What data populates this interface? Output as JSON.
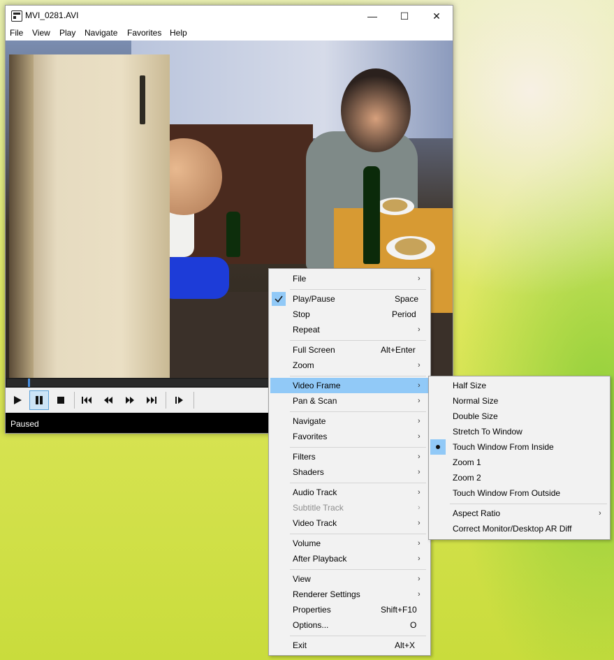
{
  "window": {
    "title": "MVI_0281.AVI",
    "controls": {
      "minimize": "—",
      "maximize": "☐",
      "close": "✕"
    },
    "menubar": [
      "File",
      "View",
      "Play",
      "Navigate",
      "Favorites",
      "Help"
    ],
    "status": "Paused",
    "seek_position": 0.05
  },
  "player_controls": [
    "play-icon",
    "pause-icon",
    "stop-icon",
    "previous-icon",
    "rewind-icon",
    "fast-forward-icon",
    "next-icon",
    "frame-step-icon"
  ],
  "context_menu": {
    "items": [
      {
        "label": "File",
        "shortcut": "",
        "submenu": true
      },
      {
        "label": "Play/Pause",
        "shortcut": "Space",
        "checked": true
      },
      {
        "label": "Stop",
        "shortcut": "Period"
      },
      {
        "label": "Repeat",
        "shortcut": "",
        "submenu": true
      },
      {
        "label": "Full Screen",
        "shortcut": "Alt+Enter"
      },
      {
        "label": "Zoom",
        "shortcut": "",
        "submenu": true
      },
      {
        "label": "Video Frame",
        "shortcut": "",
        "submenu": true,
        "highlighted": true
      },
      {
        "label": "Pan & Scan",
        "shortcut": "",
        "submenu": true
      },
      {
        "label": "Navigate",
        "shortcut": "",
        "submenu": true
      },
      {
        "label": "Favorites",
        "shortcut": "",
        "submenu": true
      },
      {
        "label": "Filters",
        "shortcut": "",
        "submenu": true
      },
      {
        "label": "Shaders",
        "shortcut": "",
        "submenu": true
      },
      {
        "label": "Audio Track",
        "shortcut": "",
        "submenu": true
      },
      {
        "label": "Subtitle Track",
        "shortcut": "",
        "submenu": true,
        "disabled": true
      },
      {
        "label": "Video Track",
        "shortcut": "",
        "submenu": true
      },
      {
        "label": "Volume",
        "shortcut": "",
        "submenu": true
      },
      {
        "label": "After Playback",
        "shortcut": "",
        "submenu": true
      },
      {
        "label": "View",
        "shortcut": "",
        "submenu": true
      },
      {
        "label": "Renderer Settings",
        "shortcut": "",
        "submenu": true
      },
      {
        "label": "Properties",
        "shortcut": "Shift+F10"
      },
      {
        "label": "Options...",
        "shortcut": "O"
      },
      {
        "label": "Exit",
        "shortcut": "Alt+X"
      }
    ]
  },
  "video_frame_submenu": {
    "items": [
      {
        "label": "Half Size"
      },
      {
        "label": "Normal Size"
      },
      {
        "label": "Double Size"
      },
      {
        "label": "Stretch To Window"
      },
      {
        "label": "Touch Window From Inside",
        "selected": true
      },
      {
        "label": "Zoom 1"
      },
      {
        "label": "Zoom 2"
      },
      {
        "label": "Touch Window From Outside"
      },
      {
        "label": "Aspect Ratio",
        "submenu": true
      },
      {
        "label": "Correct Monitor/Desktop AR Diff"
      }
    ]
  },
  "colors": {
    "highlight": "#91c9f7",
    "seek_thumb": "#4a90e2"
  }
}
